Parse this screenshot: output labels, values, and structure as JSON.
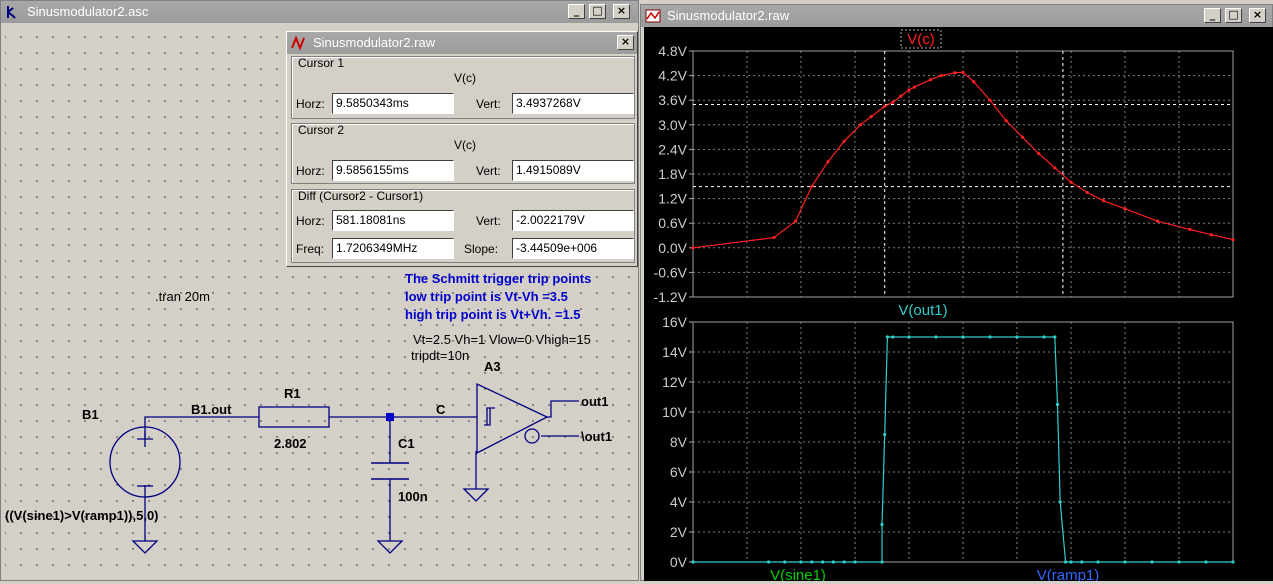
{
  "schematic_window": {
    "title": "Sinusmodulator2.asc",
    "min_btn": "_",
    "max_btn": "□",
    "close_btn": "×"
  },
  "schematic": {
    "directive_tran": ".tran 20m",
    "comment_lines": [
      "The Schmitt trigger trip points",
      "low trip point is Vt-Vh =3.5",
      "high trip point is Vt+Vh. =1.5"
    ],
    "params_line1": "Vt=2.5 Vh=1 Vlow=0 Vhigh=15",
    "params_line2": "tripdt=10n",
    "b1_name": "B1",
    "b1_expr": "((V(sine1)>V(ramp1)),5,0)",
    "b1_out_label": "B1.out",
    "r1_name": "R1",
    "r1_value": "2.802",
    "node_c": "C",
    "c1_name": "C1",
    "c1_value": "100n",
    "a3_name": "A3",
    "out1_label": "out1",
    "out1_bar_label": "\\out1"
  },
  "cursor_window": {
    "title": "Sinusmodulator2.raw",
    "close_btn": "×",
    "cursor1": {
      "legend": "Cursor 1",
      "trace": "V(c)",
      "horz_label": "Horz:",
      "horz": "9.5850343ms",
      "vert_label": "Vert:",
      "vert": "3.4937268V"
    },
    "cursor2": {
      "legend": "Cursor 2",
      "trace": "V(c)",
      "horz_label": "Horz:",
      "horz": "9.5856155ms",
      "vert_label": "Vert:",
      "vert": "1.4915089V"
    },
    "diff": {
      "legend": "Diff (Cursor2 - Cursor1)",
      "horz_label": "Horz:",
      "horz": "581.18081ns",
      "vert_label": "Vert:",
      "vert": "-2.0022179V",
      "freq_label": "Freq:",
      "freq": "1.7206349MHz",
      "slope_label": "Slope:",
      "slope": "-3.44509e+006"
    }
  },
  "plot_window": {
    "title": "Sinusmodulator2.raw",
    "min_btn": "_",
    "max_btn": "□",
    "close_btn": "×"
  },
  "colors": {
    "vc": "#ff2020",
    "out1": "#33cccc",
    "sine1": "#00cc00",
    "ramp1": "#3366ff",
    "wire": "#000080"
  },
  "chart_data": [
    {
      "type": "line",
      "title": "V(c)",
      "y_ticks": [
        "4.8V",
        "4.2V",
        "3.6V",
        "3.0V",
        "2.4V",
        "1.8V",
        "1.2V",
        "0.6V",
        "0.0V",
        "-0.6V",
        "-1.2V"
      ],
      "ylim": [
        -1.2,
        4.8
      ],
      "xlim": [
        0,
        1
      ],
      "series": [
        {
          "name": "V(c)",
          "x": [
            0,
            0.15,
            0.19,
            0.22,
            0.25,
            0.28,
            0.31,
            0.33,
            0.355,
            0.37,
            0.385,
            0.4,
            0.41,
            0.44,
            0.46,
            0.485,
            0.5,
            0.52,
            0.55,
            0.58,
            0.61,
            0.64,
            0.67,
            0.7,
            0.73,
            0.76,
            0.8,
            0.86,
            0.92,
            0.96,
            1.0
          ],
          "y": [
            0.0,
            0.25,
            0.65,
            1.5,
            2.1,
            2.6,
            3.0,
            3.2,
            3.45,
            3.55,
            3.7,
            3.85,
            3.92,
            4.1,
            4.2,
            4.27,
            4.28,
            4.05,
            3.6,
            3.1,
            2.7,
            2.3,
            1.95,
            1.6,
            1.35,
            1.15,
            0.95,
            0.65,
            0.45,
            0.32,
            0.2
          ]
        }
      ],
      "cursor_h": [
        3.4937268,
        1.4915089
      ],
      "cursor_x": [
        0.355,
        0.685
      ],
      "grid": true
    },
    {
      "type": "line",
      "title": "V(out1)",
      "y_ticks": [
        "16V",
        "14V",
        "12V",
        "10V",
        "8V",
        "6V",
        "4V",
        "2V",
        "0V"
      ],
      "ylim": [
        0,
        16
      ],
      "xlim": [
        0,
        1
      ],
      "series": [
        {
          "name": "V(out1)",
          "x": [
            0,
            0.14,
            0.17,
            0.2,
            0.22,
            0.24,
            0.26,
            0.28,
            0.3,
            0.35,
            0.35,
            0.355,
            0.36,
            0.37,
            0.4,
            0.45,
            0.5,
            0.55,
            0.6,
            0.65,
            0.67,
            0.675,
            0.68,
            0.69,
            0.7,
            0.72,
            0.75,
            0.8,
            0.85,
            0.9,
            0.95,
            1.0
          ],
          "y": [
            0,
            0,
            0,
            0,
            0,
            0,
            0,
            0,
            0,
            0,
            2.5,
            8.5,
            15,
            15,
            15,
            15,
            15,
            15,
            15,
            15,
            15,
            10.5,
            4,
            0,
            0,
            0,
            0,
            0,
            0,
            0,
            0,
            0
          ]
        }
      ],
      "grid": true,
      "bottom_labels": [
        "V(sine1)",
        "V(ramp1)"
      ]
    }
  ]
}
